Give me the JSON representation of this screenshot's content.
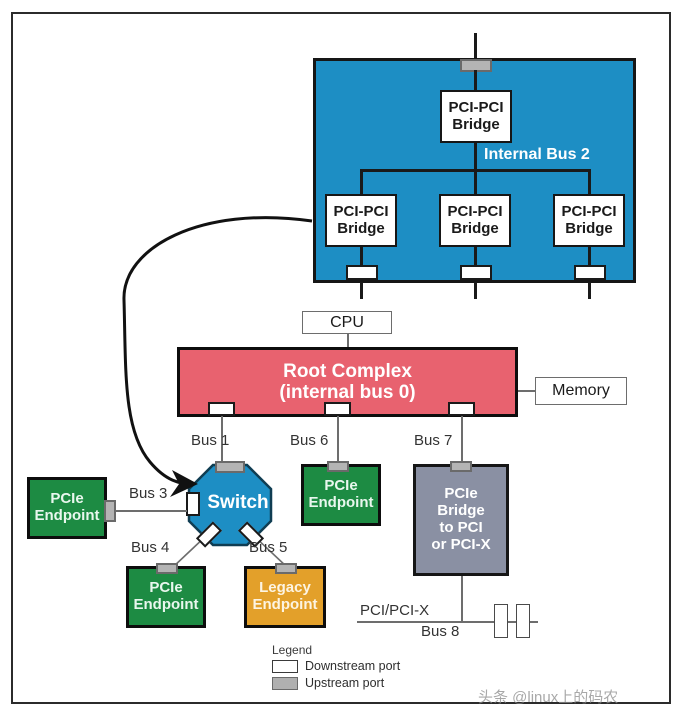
{
  "diagram": {
    "title": "PCI Express topology diagram",
    "colors": {
      "switch_blue": "#1d8ec4",
      "root_complex_red": "#e8626f",
      "endpoint_green": "#1d8b43",
      "legacy_orange": "#e3a02a",
      "bridge_gray": "#8a90a3",
      "port_upstream_gray": "#b4b4b4",
      "port_downstream_white": "#ffffff",
      "line_black": "#1a1a1a"
    }
  },
  "switch_block": {
    "upstream_bridge_label": "PCI-PCI\nBridge",
    "upstream_bridge_line1": "PCI-PCI",
    "upstream_bridge_line2": "Bridge",
    "internal_bus_label": "Internal Bus 2",
    "downstream_bridges": [
      {
        "line1": "PCI-PCI",
        "line2": "Bridge"
      },
      {
        "line1": "PCI-PCI",
        "line2": "Bridge"
      },
      {
        "line1": "PCI-PCI",
        "line2": "Bridge"
      }
    ]
  },
  "root": {
    "cpu_label": "CPU",
    "memory_label": "Memory",
    "root_complex_line1": "Root Complex",
    "root_complex_line2": "(internal bus 0)"
  },
  "buses": {
    "bus1": "Bus 1",
    "bus3": "Bus 3",
    "bus4": "Bus 4",
    "bus5": "Bus 5",
    "bus6": "Bus 6",
    "bus7": "Bus 7",
    "bus8": "Bus 8",
    "pci_pcix": "PCI/PCI-X"
  },
  "nodes": {
    "switch_label": "Switch",
    "endpoint_left_line1": "PCIe",
    "endpoint_left_line2": "Endpoint",
    "endpoint_bottom_line1": "PCIe",
    "endpoint_bottom_line2": "Endpoint",
    "legacy_line1": "Legacy",
    "legacy_line2": "Endpoint",
    "endpoint_bus6_line1": "PCIe",
    "endpoint_bus6_line2": "Endpoint",
    "pcie_bridge_line1": "PCIe",
    "pcie_bridge_line2": "Bridge",
    "pcie_bridge_line3": "to PCI",
    "pcie_bridge_line4": "or PCI-X"
  },
  "legend": {
    "title": "Legend",
    "items": [
      {
        "swatch": "downstream-port-swatch",
        "label": "Downstream port"
      },
      {
        "swatch": "upstream-port-swatch",
        "label": "Upstream port"
      }
    ]
  },
  "watermark": {
    "text": "头条 @linux上的码农"
  }
}
